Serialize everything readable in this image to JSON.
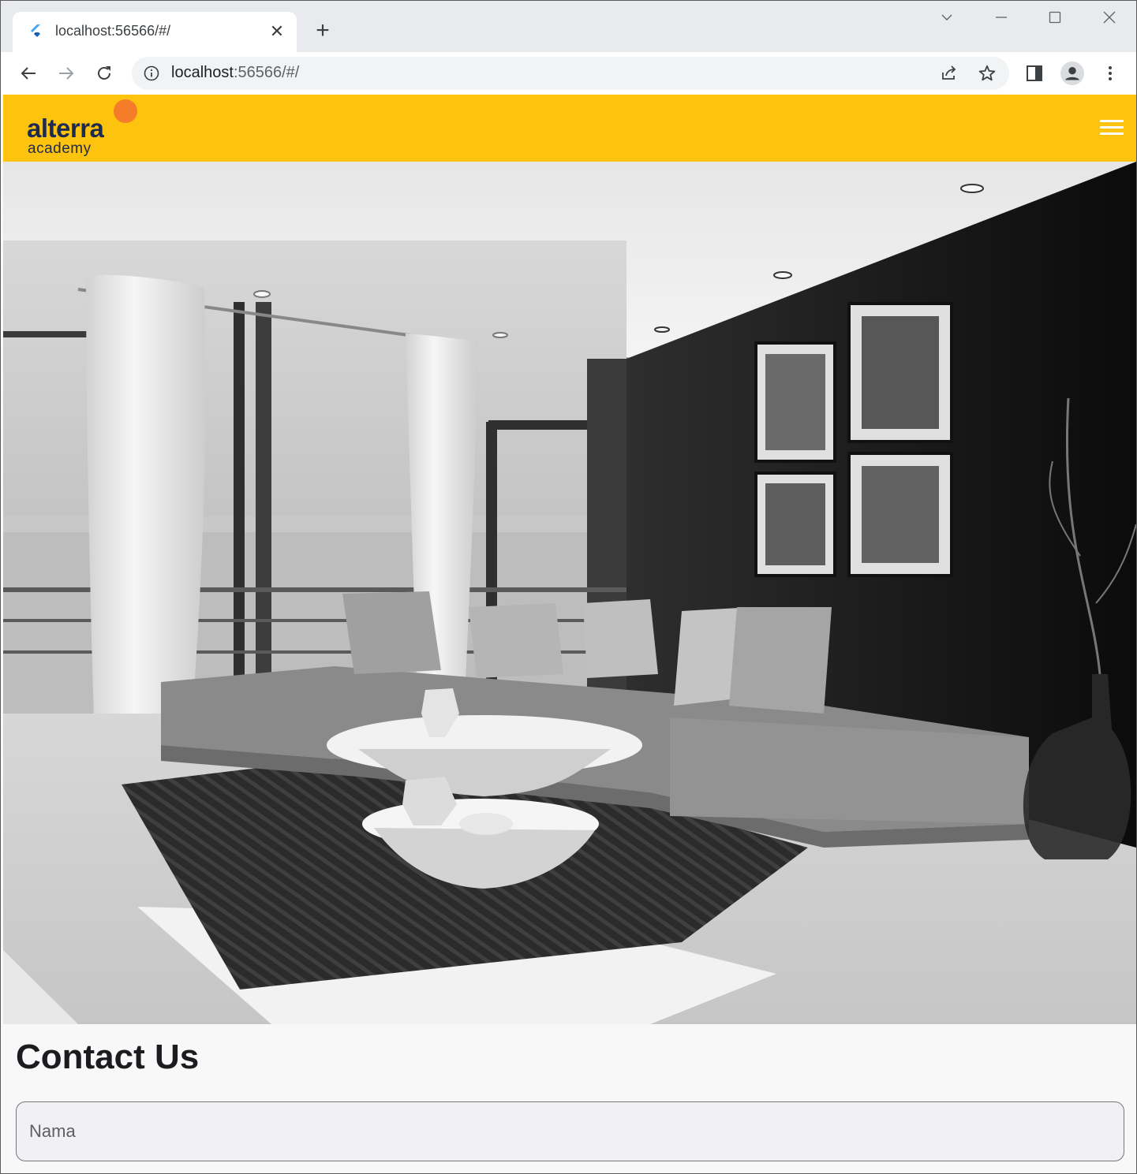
{
  "browser": {
    "tab_title": "localhost:56566/#/",
    "url_host": "localhost",
    "url_rest": ":56566/#/",
    "icons": {
      "favicon": "flutter-icon",
      "close": "close-icon",
      "new_tab": "plus-icon",
      "back": "arrow-left-icon",
      "forward": "arrow-right-icon",
      "reload": "reload-icon",
      "info": "info-icon",
      "share": "share-icon",
      "bookmark": "star-icon",
      "side_panel": "side-panel-icon",
      "profile": "profile-icon",
      "menu": "kebab-menu-icon"
    }
  },
  "appbar": {
    "logo_main": "alterra",
    "logo_sub": "academy",
    "color": "#fec30e",
    "logo_accent": "#f57c28",
    "logo_text_color": "#1d2b4f"
  },
  "hero": {
    "image": "black and white living room interior photo"
  },
  "contact": {
    "title": "Contact Us",
    "name_placeholder": "Nama"
  }
}
